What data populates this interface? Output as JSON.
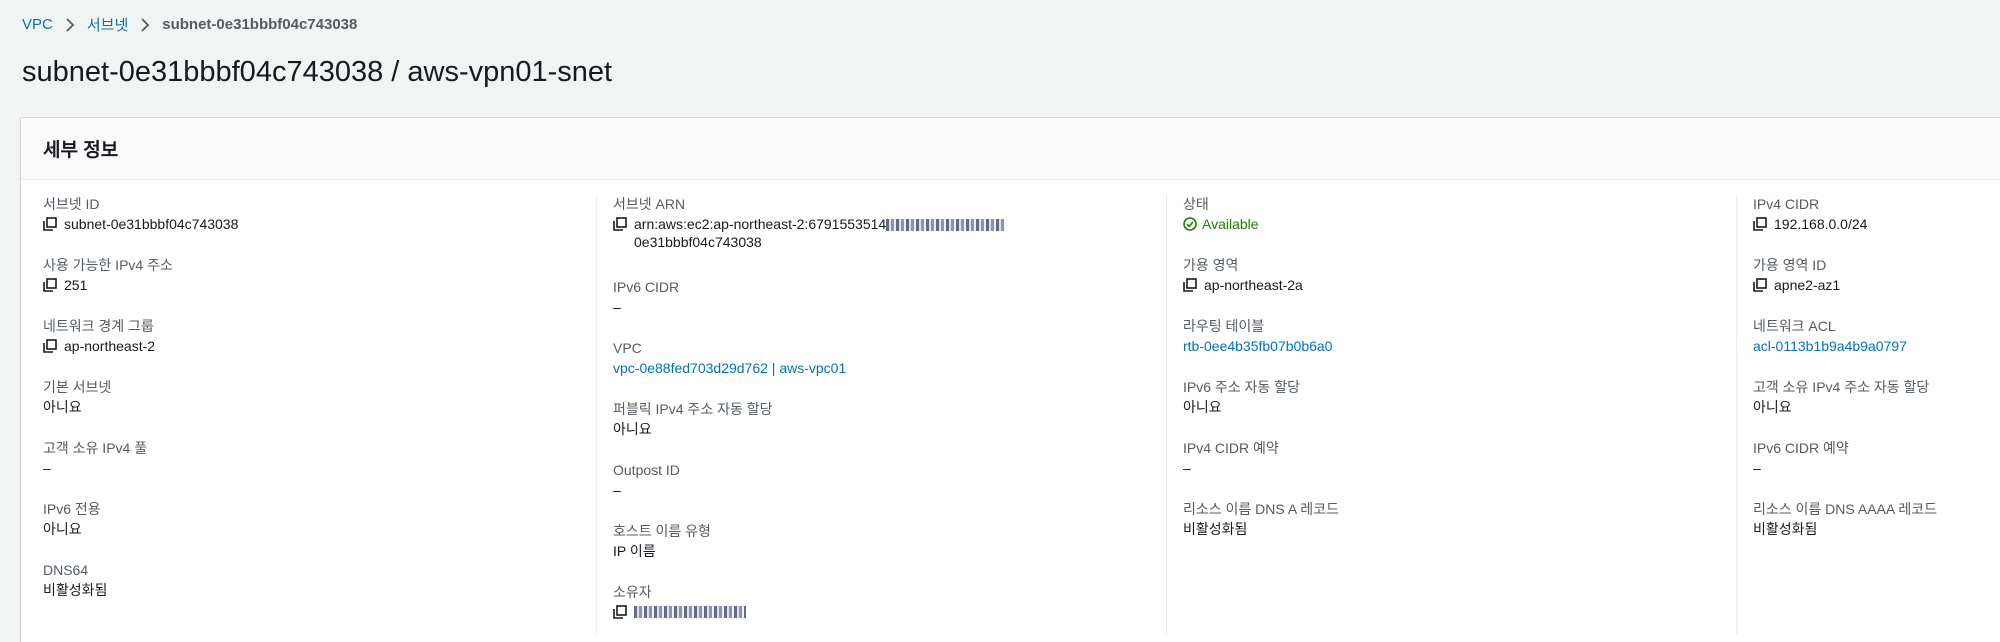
{
  "breadcrumb": {
    "items": [
      "VPC",
      "서브넷"
    ],
    "current": "subnet-0e31bbbf04c743038"
  },
  "title": "subnet-0e31bbbf04c743038 / aws-vpn01-snet",
  "panel": {
    "header": "세부 정보",
    "col1": [
      {
        "label": "서브넷 ID",
        "value": "subnet-0e31bbbf04c743038"
      },
      {
        "label": "사용 가능한 IPv4 주소",
        "value": "251"
      },
      {
        "label": "네트워크 경계 그룹",
        "value": "ap-northeast-2"
      },
      {
        "label": "기본 서브넷",
        "value": "아니요"
      },
      {
        "label": "고객 소유 IPv4 풀",
        "value": "–"
      },
      {
        "label": "IPv6 전용",
        "value": "아니요"
      },
      {
        "label": "DNS64",
        "value": "비활성화됨"
      }
    ],
    "col2": [
      {
        "label": "서브넷 ARN",
        "value": "arn:aws:ec2:ap-northeast-2:6791553514",
        "value_line2": "0e31bbbf04c743038"
      },
      {
        "label": "IPv6 CIDR",
        "value": "–"
      },
      {
        "label": "VPC",
        "value": "vpc-0e88fed703d29d762 | aws-vpc01"
      },
      {
        "label": "퍼블릭 IPv4 주소 자동 할당",
        "value": "아니요"
      },
      {
        "label": "Outpost ID",
        "value": "–"
      },
      {
        "label": "호스트 이름 유형",
        "value": "IP 이름"
      },
      {
        "label": "소유자",
        "value": ""
      }
    ],
    "col3": [
      {
        "label": "상태",
        "value": "Available"
      },
      {
        "label": "가용 영역",
        "value": "ap-northeast-2a"
      },
      {
        "label": "라우팅 테이블",
        "value": "rtb-0ee4b35fb07b0b6a0"
      },
      {
        "label": "IPv6 주소 자동 할당",
        "value": "아니요"
      },
      {
        "label": "IPv4 CIDR 예약",
        "value": "–"
      },
      {
        "label": "리소스 이름 DNS A 레코드",
        "value": "비활성화됨"
      }
    ],
    "col4": [
      {
        "label": "IPv4 CIDR",
        "value": "192.168.0.0/24"
      },
      {
        "label": "가용 영역 ID",
        "value": "apne2-az1"
      },
      {
        "label": "네트워크 ACL",
        "value": "acl-0113b1b9a4b9a0797"
      },
      {
        "label": "고객 소유 IPv4 주소 자동 할당",
        "value": "아니요"
      },
      {
        "label": "IPv6 CIDR 예약",
        "value": "–"
      },
      {
        "label": "리소스 이름 DNS AAAA 레코드",
        "value": "비활성화됨"
      }
    ]
  },
  "colors": {
    "link": "#0073bb",
    "success": "#1d8102",
    "label": "#545b64",
    "text": "#16191f"
  }
}
